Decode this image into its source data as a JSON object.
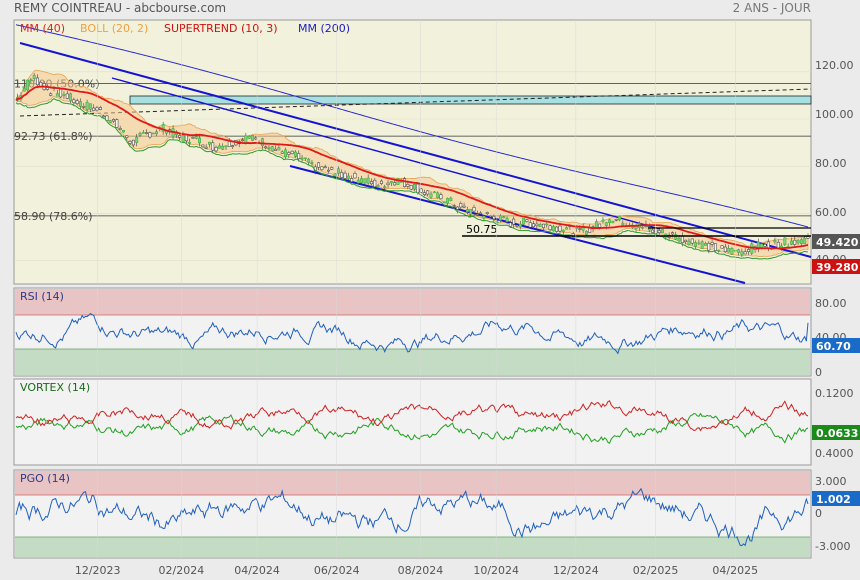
{
  "header": {
    "title": "REMY COINTREAU - abcbourse.com",
    "period": "2 ANS - JOUR"
  },
  "legend": [
    {
      "label": "MM (40)",
      "color": "#dd2222"
    },
    {
      "label": "BOLL (20, 2)",
      "color": "#f0a040"
    },
    {
      "label": "SUPERTREND (10, 3)",
      "color": "#cc1111"
    },
    {
      "label": "MM (200)",
      "color": "#1a1ac8"
    }
  ],
  "chart_data": [
    {
      "type": "line",
      "name": "price",
      "yticks": [
        "120.00",
        "100.00",
        "80.00",
        "60.00",
        "40.00"
      ],
      "ylim": [
        30,
        142
      ],
      "xticks": [
        "12/2023",
        "02/2024",
        "04/2024",
        "06/2024",
        "08/2024",
        "10/2024",
        "12/2024",
        "02/2025",
        "04/2025"
      ],
      "fib_levels": [
        {
          "label": "110.00 (50.0%)",
          "value": 115.0
        },
        {
          "label": "92.73 (61.8%)",
          "value": 92.73
        },
        {
          "label": "58.90 (78.6%)",
          "value": 58.9
        }
      ],
      "annotations": [
        {
          "label": "50.75",
          "value": 50.75
        }
      ],
      "price_badges": [
        {
          "label": "49.420",
          "value": 49.42,
          "color": "#555555"
        },
        {
          "label": "39.280",
          "value": 39.28,
          "color": "#cc1111"
        }
      ],
      "close_approx": [
        108,
        118,
        112,
        110,
        106,
        104,
        98,
        90,
        94,
        96,
        92,
        91,
        88,
        90,
        92,
        90,
        86,
        84,
        80,
        78,
        76,
        74,
        72,
        74,
        72,
        68,
        66,
        62,
        60,
        58,
        56,
        56,
        55,
        54,
        52,
        54,
        58,
        56,
        54,
        52,
        50,
        48,
        46,
        44,
        44,
        46,
        47,
        48,
        49.42
      ]
    },
    {
      "type": "line",
      "title": "RSI (14)",
      "yticks": [
        "80.00",
        "40.00",
        "0"
      ],
      "ylim": [
        0,
        100
      ],
      "bands": [
        70,
        30
      ],
      "last": "60.70"
    },
    {
      "type": "line",
      "title": "VORTEX (14)",
      "yticks": [
        "0.1200",
        "0.4000"
      ],
      "last": "0.0633"
    },
    {
      "type": "line",
      "title": "PGO (14)",
      "yticks": [
        "3.000",
        "0",
        "-3.000"
      ],
      "ylim": [
        -4,
        4
      ],
      "bands": [
        2,
        -2
      ],
      "last": "1.002"
    }
  ]
}
